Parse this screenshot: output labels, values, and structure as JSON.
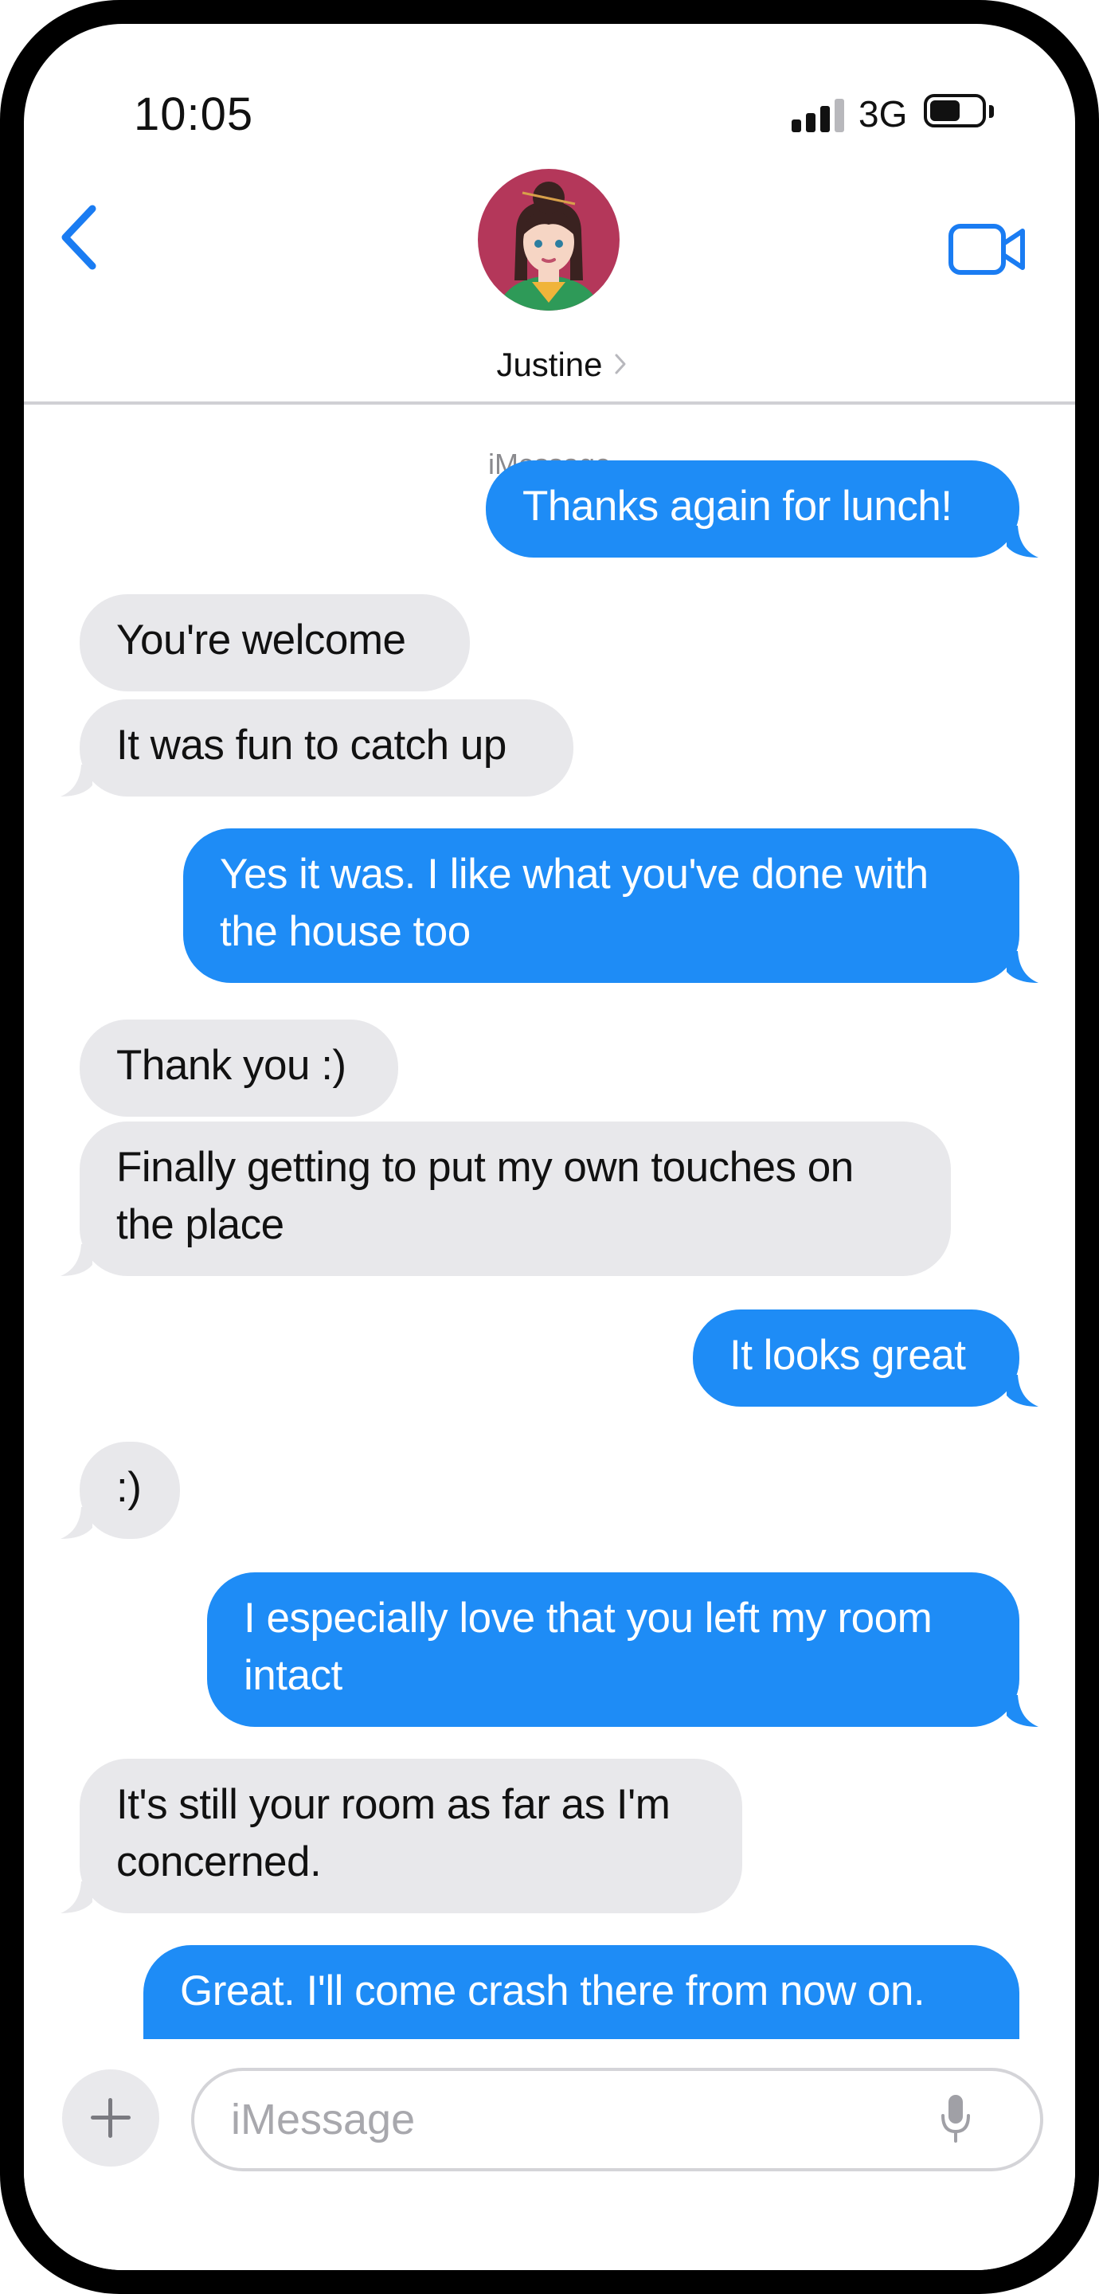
{
  "status_bar": {
    "time": "10:05",
    "network": "3G",
    "battery_level": 0.6
  },
  "header": {
    "contact_name": "Justine",
    "back_icon": "chevron-left-icon",
    "video_icon": "video-camera-icon"
  },
  "conversation": {
    "service_label": "iMessage",
    "messages": [
      {
        "from": "me",
        "text": "Thanks again for lunch!"
      },
      {
        "from": "them",
        "text": "You're welcome"
      },
      {
        "from": "them",
        "text": "It was fun to catch up"
      },
      {
        "from": "me",
        "text": "Yes it was.  I like what you've done with the house too"
      },
      {
        "from": "them",
        "text": "Thank you :)"
      },
      {
        "from": "them",
        "text": "Finally getting to put my own touches on the place"
      },
      {
        "from": "me",
        "text": "It looks great"
      },
      {
        "from": "them",
        "text": ":)"
      },
      {
        "from": "me",
        "text": "I especially love that you left my room intact"
      },
      {
        "from": "them",
        "text": "It's still your room as far as I'm concerned."
      },
      {
        "from": "me",
        "text": "Great.  I'll come crash there from now on."
      }
    ]
  },
  "composer": {
    "placeholder": "iMessage",
    "add_icon": "plus-icon",
    "mic_icon": "microphone-icon"
  },
  "colors": {
    "outgoing_bubble": "#1e8cf6",
    "incoming_bubble": "#e8e8eb",
    "accent": "#1a7cf2"
  }
}
